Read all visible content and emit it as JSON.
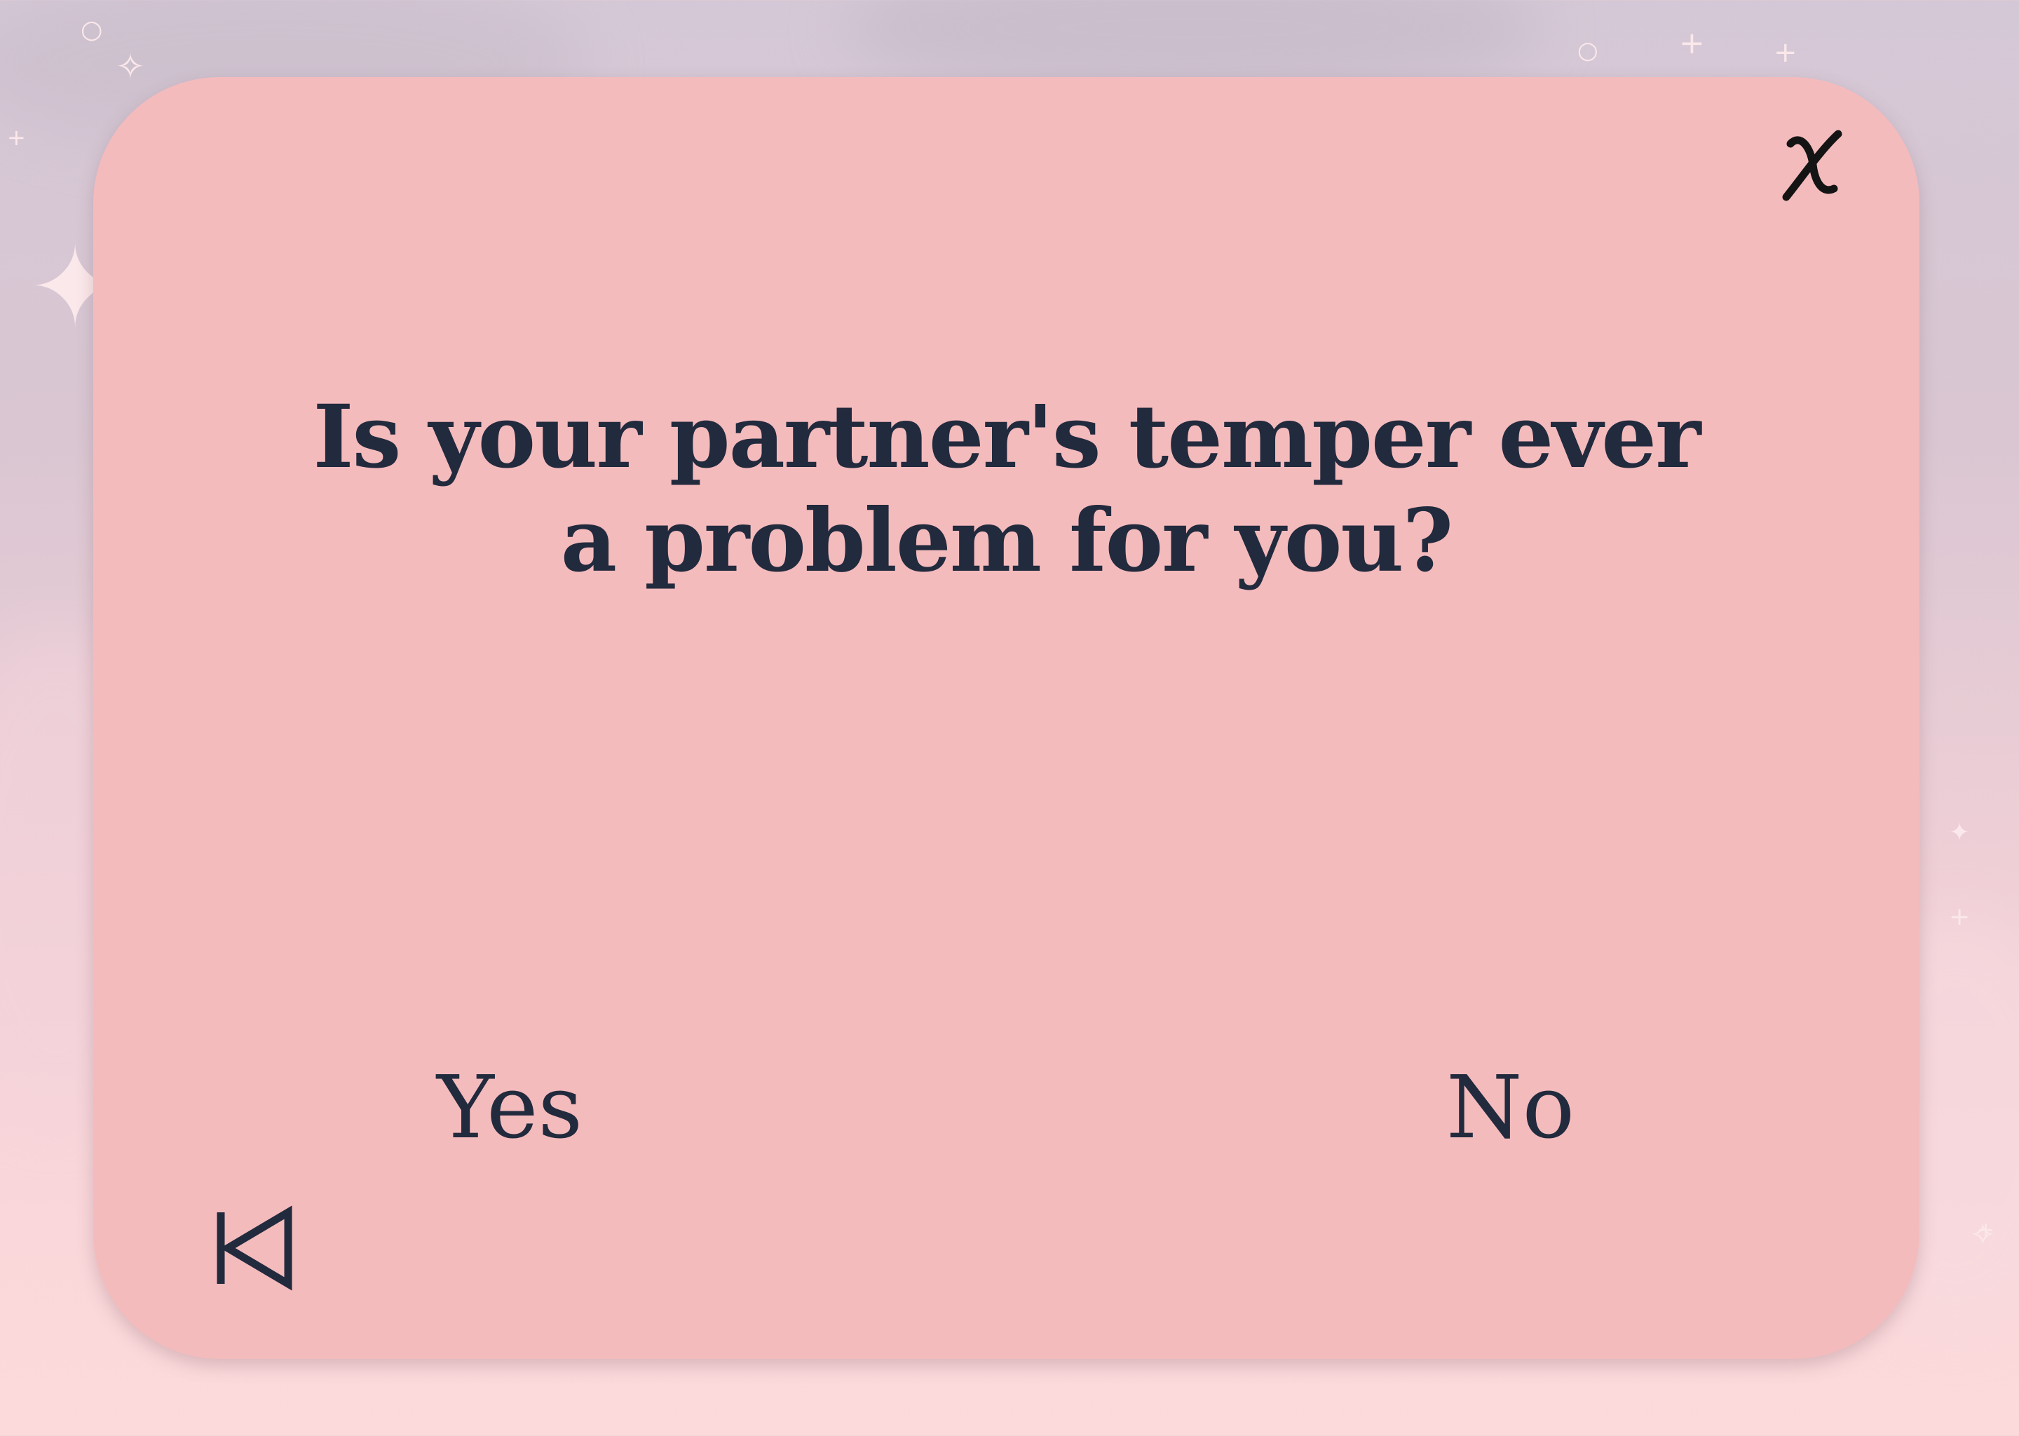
{
  "quiz": {
    "question": "Is your partner's temper ever a problem for you?",
    "answers": {
      "yes": "Yes",
      "no": "No"
    }
  },
  "controls": {
    "close_icon": "close-x-icon",
    "back_icon": "skip-back-icon"
  },
  "colors": {
    "card": "#f4bbbd",
    "text": "#222a3d",
    "background_top": "#d5c8d6",
    "background_bottom": "#fcdadb"
  }
}
